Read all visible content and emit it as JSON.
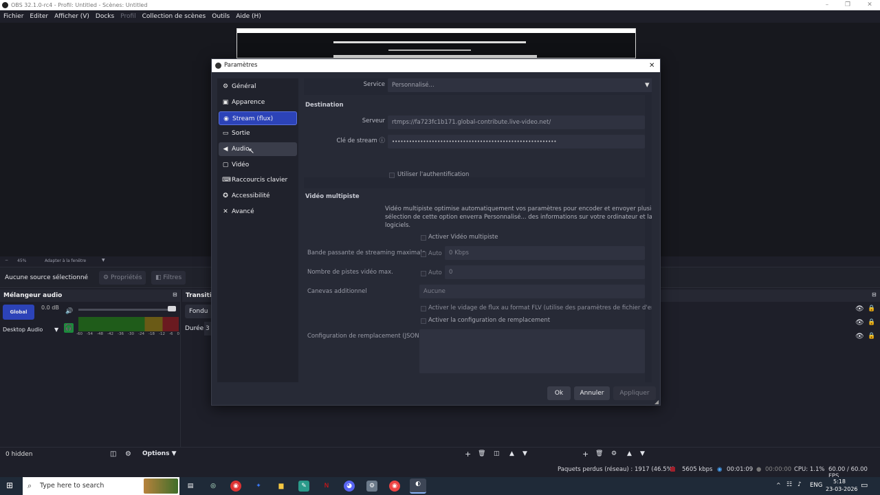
{
  "window": {
    "title": "OBS 32.1.0-rc4 - Profil: Untitled - Scènes: Untitled"
  },
  "menu": [
    "Fichier",
    "Editer",
    "Afficher (V)",
    "Docks",
    "Profil",
    "Collection de scènes",
    "Outils",
    "Aide (H)"
  ],
  "zoom": {
    "level": "45%",
    "fit": "Adapter à la fenêtre"
  },
  "source_bar": {
    "none_selected": "Aucune source sélectionné",
    "properties": "Propriétés",
    "filters": "Filtres"
  },
  "mixer": {
    "title": "Mélangeur audio",
    "channel1": "Global",
    "db": "0.0 dB",
    "channel2": "Desktop Audio",
    "ticks": [
      "-60",
      "-54",
      "-48",
      "-42",
      "-36",
      "-30",
      "-24",
      "-18",
      "-12",
      "-6",
      "0"
    ]
  },
  "transitions": {
    "title": "Transiti",
    "fade": "Fondu",
    "duration": "Durée",
    "duration_val": "3"
  },
  "bottom": {
    "hidden": "0 hidden",
    "options": "Options"
  },
  "status": {
    "dropped": "Paquets perdus (réseau) : 1917 (46.5%)",
    "kbps": "5605 kbps",
    "stream_time": "00:01:09",
    "rec_time": "00:00:00",
    "cpu": "CPU: 1.1%",
    "fps": "60.00 / 60.00 FPS"
  },
  "taskbar": {
    "search": "Type here to search",
    "lang": "ENG",
    "time": "5:18",
    "date": "23-03-2026"
  },
  "dialog": {
    "title": "Paramètres",
    "nav": [
      {
        "label": "Général",
        "icon": "⚙"
      },
      {
        "label": "Apparence",
        "icon": "▣"
      },
      {
        "label": "Stream (flux)",
        "icon": "◉"
      },
      {
        "label": "Sortie",
        "icon": "▭"
      },
      {
        "label": "Audio",
        "icon": "◀"
      },
      {
        "label": "Vidéo",
        "icon": "▢"
      },
      {
        "label": "Raccourcis clavier",
        "icon": "⌨"
      },
      {
        "label": "Accessibilité",
        "icon": "✪"
      },
      {
        "label": "Avancé",
        "icon": "✕"
      }
    ],
    "service_label": "Service",
    "service_value": "Personnalisé...",
    "destination": "Destination",
    "server_label": "Serveur",
    "server_value": "rtmps://fa723fc1b171.global-contribute.live-video.net/",
    "key_label": "Clé de stream",
    "key_value": "••••••••••••••••••••••••••••••••••••••••••••••••••••••••••",
    "use_auth": "Utiliser l'authentification",
    "multitrack": "Vidéo multipiste",
    "multitrack_desc1": "Vidéo multipiste optimise automatiquement vos paramètres pour encoder et envoyer plusieurs",
    "multitrack_desc2": "sélection de cette option enverra Personnalisé... des informations sur votre ordinateur et la conf",
    "multitrack_desc3": "logiciels.",
    "enable_multitrack": "Activer Vidéo multipiste",
    "max_bw_label": "Bande passante de streaming maximale",
    "auto": "Auto",
    "max_bw_value": "0 Kbps",
    "max_tracks_label": "Nombre de pistes vidéo max.",
    "max_tracks_value": "0",
    "extra_canvas_label": "Canevas additionnel",
    "extra_canvas_value": "Aucune",
    "flv_dump": "Activer le vidage de flux au format FLV (utilise des paramètres de fichier d'enregi",
    "override_cfg": "Activer la configuration de remplacement",
    "override_json_label": "Configuration de remplacement (JSON)",
    "ok": "Ok",
    "cancel": "Annuler",
    "apply": "Appliquer"
  }
}
